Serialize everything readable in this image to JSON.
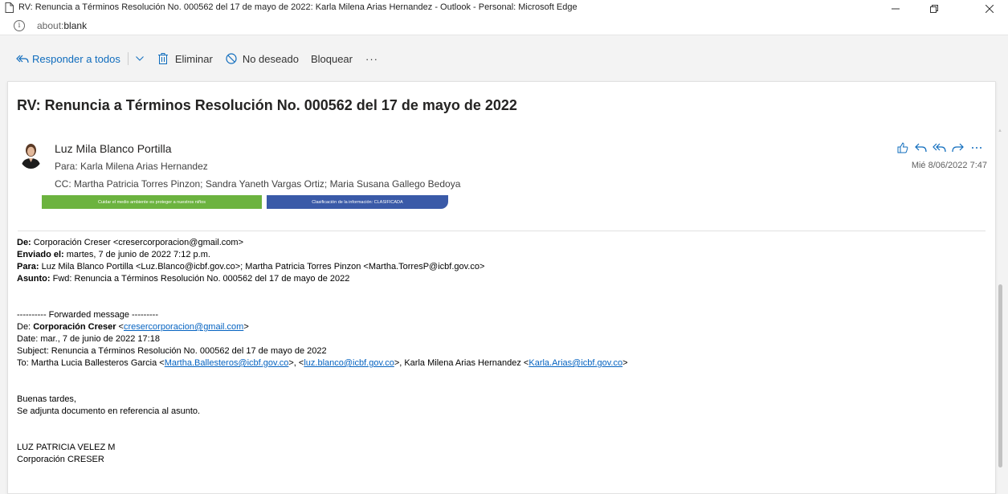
{
  "window": {
    "title": "RV: Renuncia a Términos Resolución No. 000562 del 17 de mayo de 2022: Karla Milena Arias Hernandez - Outlook - Personal: Microsoft Edge",
    "address_prefix": "about:",
    "address_main": "blank"
  },
  "toolbar": {
    "reply_all": "Responder a todos",
    "delete": "Eliminar",
    "junk": "No deseado",
    "block": "Bloquear",
    "more": "···"
  },
  "email": {
    "subject": "RV: Renuncia a Términos Resolución No. 000562 del 17 de mayo de 2022",
    "sender": "Luz Mila Blanco Portilla",
    "to": "Para:  Karla Milena Arias Hernandez",
    "cc": "CC:  Martha Patricia Torres Pinzon;  Sandra Yaneth Vargas Ortiz;  Maria Susana Gallego Bedoya",
    "date": "Mié 8/06/2022 7:47",
    "banner_green": "Cuidar el medio ambiente es proteger a nuestros niños",
    "banner_blue": "Clasificación de la información: CLASIFICADA"
  },
  "body": {
    "h_from_label": "De:",
    "h_from": " Corporación Creser <cresercorporacion@gmail.com>",
    "h_sent_label": "Enviado el:",
    "h_sent": " martes, 7 de junio de 2022 7:12 p.m.",
    "h_to_label": "Para:",
    "h_to": " Luz Mila Blanco Portilla <Luz.Blanco@icbf.gov.co>; Martha Patricia Torres Pinzon <Martha.TorresP@icbf.gov.co>",
    "h_subject_label": "Asunto:",
    "h_subject": " Fwd: Renuncia a Términos Resolución No. 000562 del 17 de mayo de 2022",
    "fwd_marker": "---------- Forwarded message ---------",
    "fwd_from_label": "De: ",
    "fwd_from_name": "Corporación Creser",
    "fwd_from_lt": " <",
    "fwd_from_email": "cresercorporacion@gmail.com",
    "fwd_from_gt": ">",
    "fwd_date": "Date: mar., 7 de junio de 2022 17:18",
    "fwd_subject": "Subject: Renuncia a Términos Resolución No. 000562 del 17 de mayo de 2022",
    "fwd_to_1": "To: Martha Lucia Ballesteros Garcia <",
    "fwd_to_link1": "Martha.Ballesteros@icbf.gov.co",
    "fwd_to_2": ">, <",
    "fwd_to_link2": "luz.blanco@icbf.gov.co",
    "fwd_to_3": ">, Karla Milena Arias Hernandez <",
    "fwd_to_link3": "Karla.Arias@icbf.gov.co",
    "fwd_to_4": ">",
    "greeting": "Buenas tardes,",
    "message": "Se adjunta documento en referencia al asunto.",
    "sig_name": "LUZ PATRICIA VELEZ M",
    "sig_org": "Corporación CRESER"
  }
}
